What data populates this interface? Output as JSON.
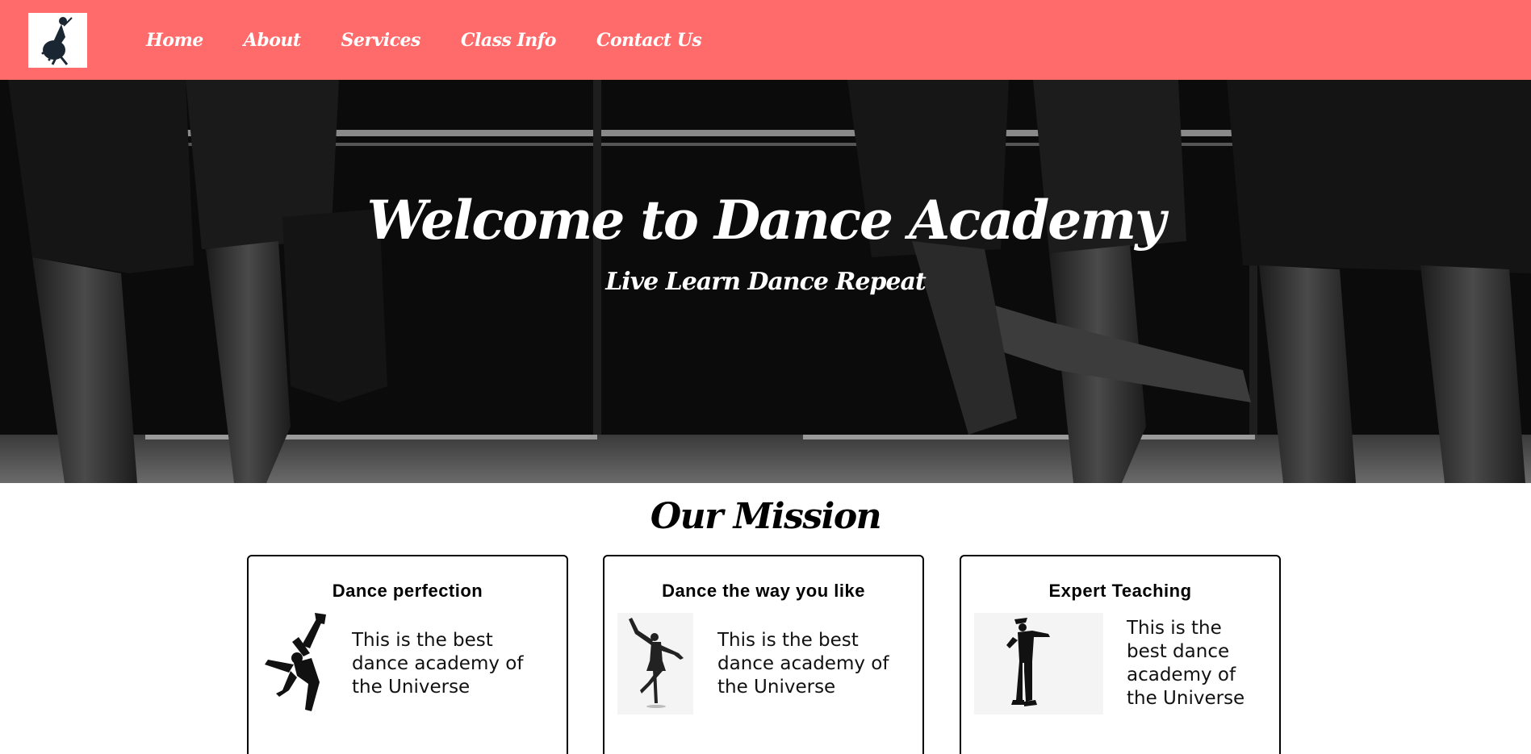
{
  "nav": {
    "logo_icon": "dancer-logo-icon",
    "links": [
      "Home",
      "About",
      "Services",
      "Class Info",
      "Contact Us"
    ]
  },
  "hero": {
    "title": "Welcome to Dance Academy",
    "subtitle": "Live Learn Dance Repeat"
  },
  "mission": {
    "title": "Our Mission",
    "cards": [
      {
        "title": "Dance perfection",
        "text": "This is the best dance academy of the Universe",
        "icon": "breakdancer-silhouette-icon"
      },
      {
        "title": "Dance the way you like",
        "text": "This is the best dance academy of the Universe",
        "icon": "ballerina-silhouette-icon"
      },
      {
        "title": "Expert Teaching",
        "text": "This is the best dance academy of the Universe",
        "icon": "moonwalk-dancer-silhouette-icon"
      }
    ]
  },
  "colors": {
    "navbar": "#ff6b6b",
    "hero_background": "#0d0d0d",
    "text_light": "#ffffff"
  }
}
